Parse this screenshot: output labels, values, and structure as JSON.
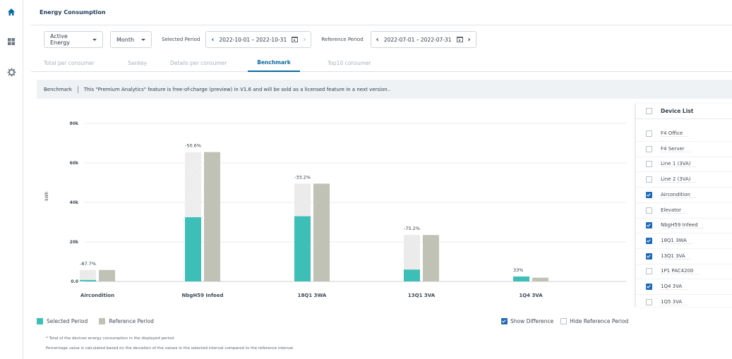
{
  "app": {
    "title": "Energy Consumption"
  },
  "rail": {
    "items": [
      {
        "icon": "home-icon"
      },
      {
        "icon": "dashboard-icon"
      },
      {
        "icon": "gear-icon"
      }
    ]
  },
  "filters": {
    "measure": "Active Energy",
    "granularity": "Month",
    "selected_label": "Selected Period",
    "selected_range": "2022-10-01 – 2022-10-31",
    "reference_label": "Reference Period",
    "reference_range": "2022-07-01 – 2022-07-31"
  },
  "tabs": [
    {
      "label": "Total per consumer",
      "active": false
    },
    {
      "label": "Sankey",
      "active": false
    },
    {
      "label": "Details per consumer",
      "active": false
    },
    {
      "label": "Benchmark",
      "active": true
    },
    {
      "label": "Top10 consumer",
      "active": false
    }
  ],
  "banner": {
    "title": "Benchmark",
    "text": "This \"Premium Analytics\" feature is free-of-charge (preview) in V1.6 and will be sold as a licensed feature in a next version.."
  },
  "chart_data": {
    "type": "bar",
    "ylabel": "kWh",
    "ylim": [
      0,
      80000
    ],
    "yticks": [
      {
        "value": 0,
        "label": "0.0"
      },
      {
        "value": 20000,
        "label": "20k"
      },
      {
        "value": 40000,
        "label": "40k"
      },
      {
        "value": 60000,
        "label": "60k"
      },
      {
        "value": 80000,
        "label": "80k"
      }
    ],
    "categories": [
      "Aircondition",
      "NbgH59 Infeed",
      "18Q1 3WA",
      "13Q1 3VA",
      "1Q4 3VA"
    ],
    "series": [
      {
        "name": "Selected Period",
        "values": [
          700,
          32500,
          33000,
          6000,
          2500
        ]
      },
      {
        "name": "Reference Period",
        "values": [
          5800,
          65500,
          49500,
          23500,
          1900
        ]
      }
    ],
    "difference_labels": [
      "-87.7%",
      "-50.6%",
      "-33.2%",
      "-75.2%",
      "33%"
    ],
    "colors": {
      "selected": "#3dbfb8",
      "reference": "#bfc2b5",
      "difference": "#ebebeb",
      "accent": "#0a6aa1"
    },
    "legend": "bottom-left",
    "grid": true
  },
  "legend": {
    "selected": "Selected Period",
    "reference": "Reference Period",
    "show_difference": "Show Difference",
    "show_difference_checked": true,
    "hide_reference": "Hide Reference Period",
    "hide_reference_checked": false
  },
  "footnotes": [
    "* Total of the devices energy consumption in the displayed period.",
    "Percentage value is calculated based on the deviation of the values in the selected interval compared to the reference interval."
  ],
  "device_list": {
    "header": "Device List",
    "items": [
      {
        "label": "F4 Office",
        "checked": false
      },
      {
        "label": "F4 Server",
        "checked": false
      },
      {
        "label": "Line 1 (3VA)",
        "checked": false
      },
      {
        "label": "Line 2 (3VA)",
        "checked": false
      },
      {
        "label": "Aircondition",
        "checked": true
      },
      {
        "label": "Elevator",
        "checked": false
      },
      {
        "label": "NbgH59 Infeed",
        "checked": true
      },
      {
        "label": "18Q1 3WA",
        "checked": true
      },
      {
        "label": "13Q1 3VA",
        "checked": true
      },
      {
        "label": "1P1 PAC4200",
        "checked": false
      },
      {
        "label": "1Q4 3VA",
        "checked": true
      },
      {
        "label": "1Q5 3VA",
        "checked": false
      }
    ]
  }
}
